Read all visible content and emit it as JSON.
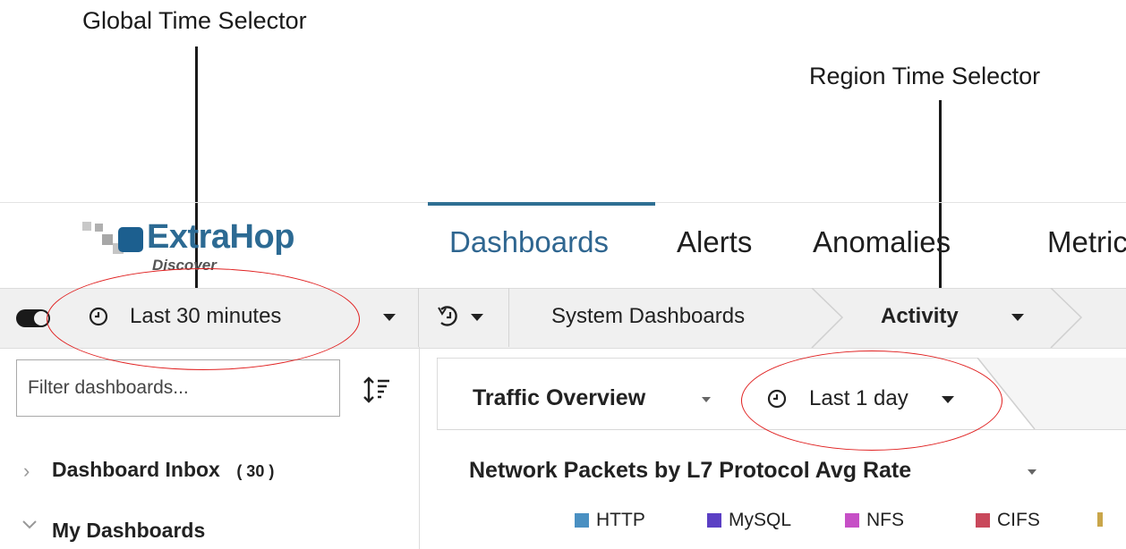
{
  "annotations": {
    "global_time_selector": "Global Time Selector",
    "region_time_selector": "Region Time Selector"
  },
  "brand": {
    "name": "ExtraHop",
    "product": "Discover"
  },
  "nav": {
    "tabs": [
      {
        "label": "Dashboards",
        "active": true
      },
      {
        "label": "Alerts"
      },
      {
        "label": "Anomalies"
      },
      {
        "label": "Metrics"
      }
    ]
  },
  "toolbar": {
    "global_time": "Last 30 minutes",
    "breadcrumb": [
      "System Dashboards",
      "Activity"
    ]
  },
  "sidebar": {
    "filter_placeholder": "Filter dashboards...",
    "items": [
      {
        "label": "Dashboard Inbox",
        "count": "( 30 )"
      },
      {
        "label": "My Dashboards"
      }
    ]
  },
  "region": {
    "title": "Traffic Overview",
    "time": "Last 1 day",
    "chart_title": "Network Packets by L7 Protocol Avg Rate",
    "legend": [
      {
        "label": "HTTP",
        "color": "#4a90c2"
      },
      {
        "label": "MySQL",
        "color": "#5b3fc4"
      },
      {
        "label": "NFS",
        "color": "#c64fc6"
      },
      {
        "label": "CIFS",
        "color": "#c9485b"
      }
    ]
  },
  "colors": {
    "brand": "#2c6a93",
    "annotation": "#e02020"
  }
}
